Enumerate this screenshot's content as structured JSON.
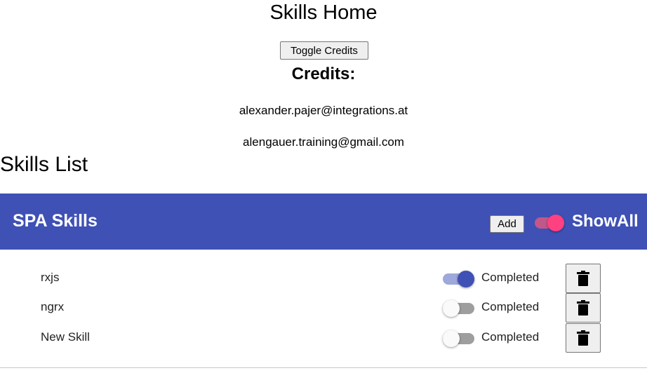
{
  "header": {
    "title": "Skills Home",
    "toggle_credits_label": "Toggle Credits",
    "credits_heading": "Credits:",
    "credits": [
      "alexander.pajer@integrations.at",
      "alengauer.training@gmail.com"
    ]
  },
  "skills_section": {
    "title": "Skills List"
  },
  "toolbar": {
    "title": "SPA Skills",
    "add_label": "Add",
    "showall_label": "ShowAll",
    "showall_on": true,
    "background": "#3f51b5",
    "accent": "#ff4081"
  },
  "skills": [
    {
      "name": "rxjs",
      "completed": true,
      "completed_label": "Completed",
      "delete_icon": "trash-icon"
    },
    {
      "name": "ngrx",
      "completed": false,
      "completed_label": "Completed",
      "delete_icon": "trash-icon"
    },
    {
      "name": "New Skill",
      "completed": false,
      "completed_label": "Completed",
      "delete_icon": "trash-icon"
    }
  ]
}
